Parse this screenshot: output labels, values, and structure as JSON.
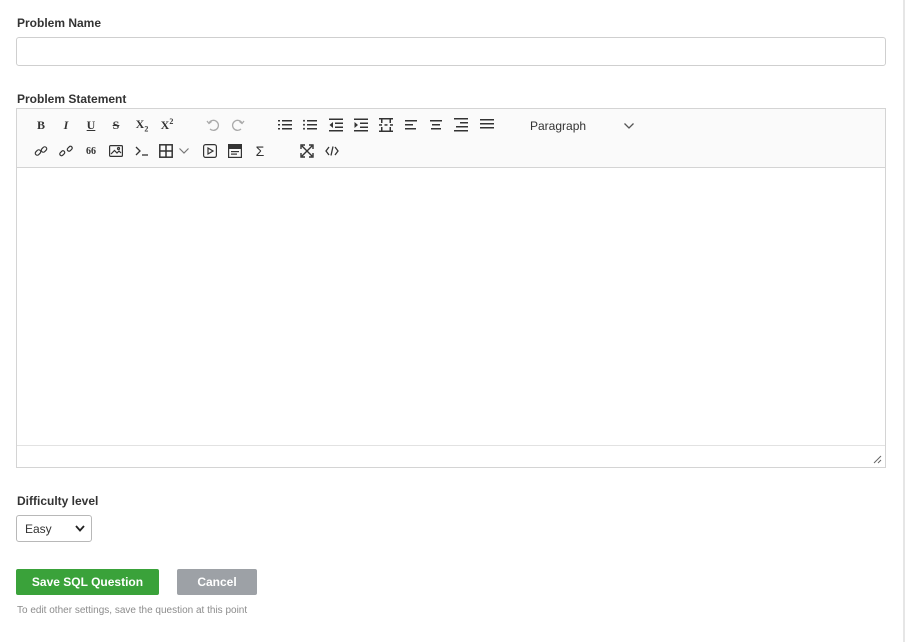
{
  "form": {
    "problem_name": {
      "label": "Problem Name",
      "value": "",
      "placeholder": ""
    },
    "problem_statement": {
      "label": "Problem Statement"
    },
    "difficulty": {
      "label": "Difficulty level",
      "selected": "Easy"
    },
    "save_label": "Save SQL Question",
    "cancel_label": "Cancel",
    "hint": "To edit other settings, save the question at this point"
  },
  "editor": {
    "paragraph_format": "Paragraph",
    "buttons": {
      "bold": "B",
      "italic": "I",
      "underline": "U",
      "strike": "S",
      "subscript": "X",
      "superscript": "X",
      "sub_mark": "2",
      "sup_mark": "2",
      "quote": "66",
      "sigma": "Σ"
    },
    "icons": [
      "bold-icon",
      "italic-icon",
      "underline-icon",
      "strikethrough-icon",
      "subscript-icon",
      "superscript-icon",
      "undo-icon",
      "redo-icon",
      "numbered-list-icon",
      "bulleted-list-icon",
      "outdent-icon",
      "indent-icon",
      "page-break-icon",
      "align-left-icon",
      "align-center-icon",
      "align-right-icon",
      "justify-icon",
      "link-icon",
      "unlink-icon",
      "blockquote-icon",
      "image-icon",
      "code-block-icon",
      "table-icon",
      "media-embed-icon",
      "html-snippet-icon",
      "math-formula-icon",
      "fullscreen-icon",
      "source-code-icon",
      "chevron-down-icon",
      "resize-grip-icon"
    ]
  },
  "colors": {
    "primary": "#3aa23a",
    "secondary": "#9da1a6",
    "border": "#d4d4d4",
    "hint": "#8c8c8c"
  }
}
